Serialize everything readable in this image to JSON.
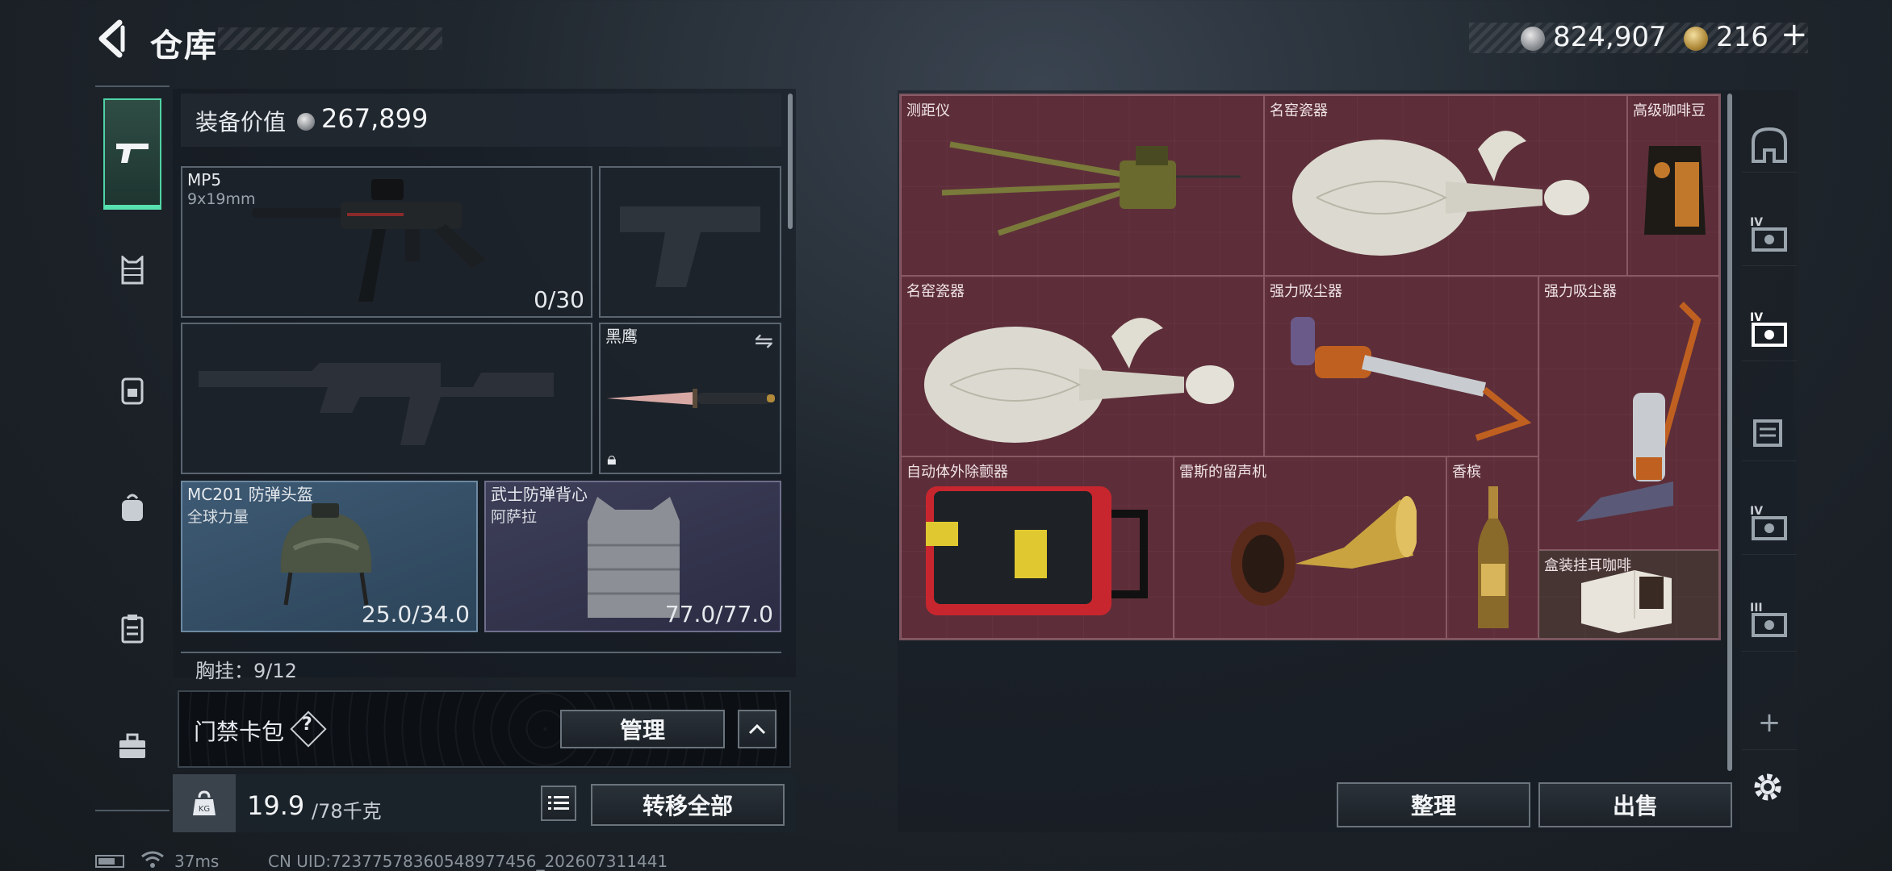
{
  "header": {
    "title": "仓库",
    "silver_amount": "824,907",
    "gold_amount": "216",
    "gold_plus": "+"
  },
  "left_rail": {
    "items": [
      {
        "icon": "pistol-icon",
        "active": true
      },
      {
        "icon": "armor-vest-icon",
        "active": false
      },
      {
        "icon": "chest-rig-icon",
        "active": false
      },
      {
        "icon": "backpack-icon",
        "active": false
      },
      {
        "icon": "clipboard-icon",
        "active": false
      },
      {
        "icon": "briefcase-icon",
        "active": false
      }
    ]
  },
  "equipment": {
    "value_label": "装备价值",
    "value": "267,899",
    "primary": {
      "name": "MP5",
      "caliber": "9x19mm",
      "ammo": "0/30"
    },
    "sidearm": {
      "empty": true
    },
    "secondary": {
      "empty": true
    },
    "melee": {
      "name": "黑鹰"
    },
    "helmet": {
      "name": "MC201 防弹头盔",
      "brand": "全球力量",
      "durability": "25.0/34.0"
    },
    "vest": {
      "name": "武士防弹背心",
      "brand": "阿萨拉",
      "durability": "77.0/77.0"
    },
    "chest_rig": "胸挂：9/12"
  },
  "card_bag": {
    "label": "门禁卡包",
    "help": "?",
    "manage_label": "管理",
    "collapse_icon": "chevron-up-icon"
  },
  "weight": {
    "current": "19.9",
    "max": "/78千克",
    "list_icon": "list-icon",
    "transfer_label": "转移全部"
  },
  "storage": {
    "items": [
      {
        "name": "测距仪",
        "kind": "rangefinder"
      },
      {
        "name": "名窑瓷器",
        "kind": "vase"
      },
      {
        "name": "高级咖啡豆",
        "kind": "coffee"
      },
      {
        "name": "名窑瓷器",
        "kind": "vase"
      },
      {
        "name": "强力吸尘器",
        "kind": "vacuum"
      },
      {
        "name": "强力吸尘器",
        "kind": "vacuum-tall"
      },
      {
        "name": "自动体外除颤器",
        "kind": "aed"
      },
      {
        "name": "雷斯的留声机",
        "kind": "gramophone"
      },
      {
        "name": "香槟",
        "kind": "champagne"
      },
      {
        "name": "盒装挂耳咖啡",
        "kind": "coffee-box"
      }
    ],
    "sort_label": "整理",
    "sell_label": "出售"
  },
  "right_rail": {
    "items": [
      {
        "icon": "safe-box-icon",
        "tier": ""
      },
      {
        "icon": "container-icon",
        "tier": "IV"
      },
      {
        "icon": "container-icon",
        "tier": "IV"
      },
      {
        "icon": "container-icon",
        "tier": ""
      },
      {
        "icon": "container-icon",
        "tier": "IV"
      },
      {
        "icon": "container-icon",
        "tier": "III"
      }
    ],
    "add_label": "+"
  },
  "footer": {
    "ping": "37ms",
    "uid": "CN UID:7237757836054897745​6_202607311441"
  },
  "colors": {
    "accent": "#57e0b0",
    "storage_bg": "#4a2a33",
    "helmet_bg": "#3e5a74",
    "vest_bg": "#3d3e58"
  }
}
